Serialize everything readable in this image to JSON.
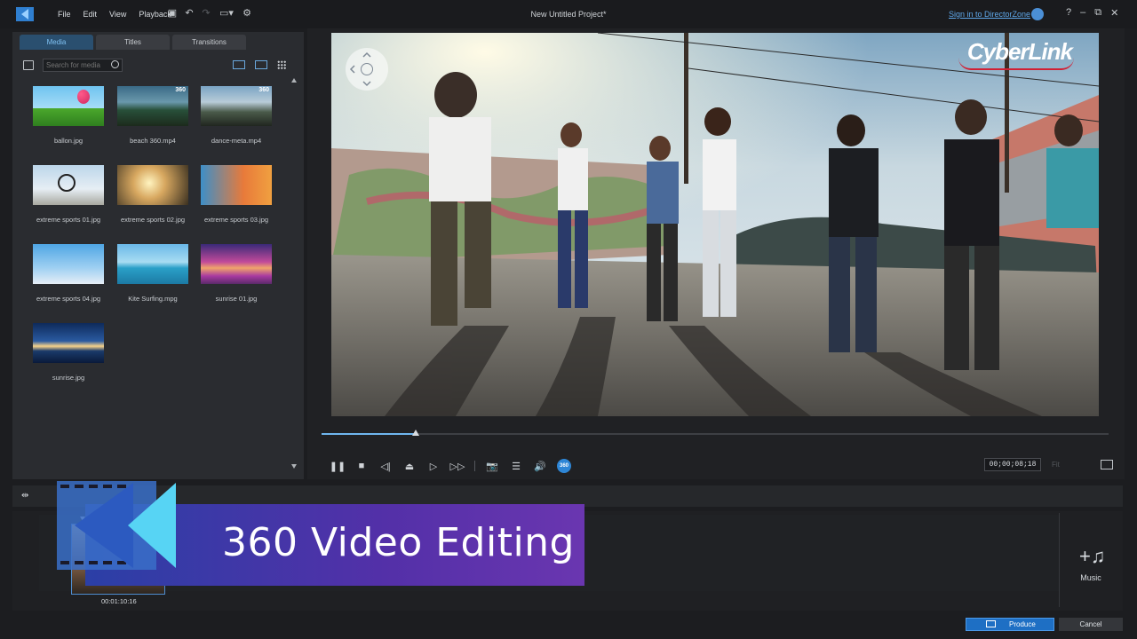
{
  "titlebar": {
    "menu": [
      "File",
      "Edit",
      "View",
      "Playback"
    ],
    "project_title": "New Untitled Project*",
    "signin": "Sign in to DirectorZone",
    "help": "?",
    "minimize": "–",
    "maximize": "⧉",
    "close": "✕"
  },
  "library": {
    "tabs": [
      "Media",
      "Titles",
      "Transitions"
    ],
    "search_placeholder": "Search for media",
    "items": [
      {
        "label": "ballon.jpg",
        "badge": ""
      },
      {
        "label": "beach 360.mp4",
        "badge": "360"
      },
      {
        "label": "dance-meta.mp4",
        "badge": "360"
      },
      {
        "label": "extreme sports 01.jpg",
        "badge": ""
      },
      {
        "label": "extreme sports 02.jpg",
        "badge": ""
      },
      {
        "label": "extreme sports 03.jpg",
        "badge": ""
      },
      {
        "label": "extreme sports 04.jpg",
        "badge": ""
      },
      {
        "label": "Kite Surfing.mpg",
        "badge": ""
      },
      {
        "label": "sunrise 01.jpg",
        "badge": ""
      },
      {
        "label": "sunrise.jpg",
        "badge": ""
      }
    ]
  },
  "preview": {
    "watermark": "CyberLink",
    "progress_fraction": 0.12,
    "timecode": "00;00;08;18",
    "fit": "Fit",
    "btn360": "360"
  },
  "timeline": {
    "clip_time": "00:01:10:16",
    "music_label": "Music"
  },
  "banner": {
    "text": "360 Video Editing"
  },
  "actions": {
    "produce": "Produce",
    "cancel": "Cancel"
  }
}
